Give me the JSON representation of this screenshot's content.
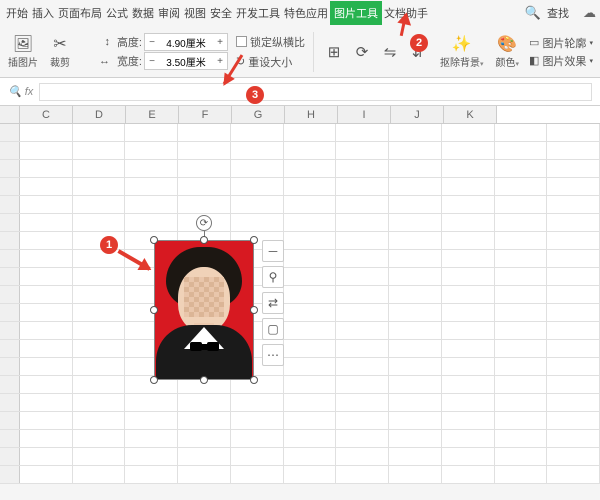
{
  "tabs": {
    "items": [
      "开始",
      "插入",
      "页面布局",
      "公式",
      "数据",
      "审阅",
      "视图",
      "安全",
      "开发工具",
      "特色应用"
    ],
    "active": "图片工具",
    "after": "文档助手",
    "find": "查找"
  },
  "ribbon": {
    "compress": "插图片",
    "crop": "裁剪",
    "height_label": "高度:",
    "width_label": "宽度:",
    "height_value": "4.90厘米",
    "width_value": "3.50厘米",
    "minus": "−",
    "plus": "+",
    "lock": "锁定纵横比",
    "reset": "重设大小",
    "removebg": "抠除背景",
    "color": "颜色",
    "outline": "图片轮廓",
    "effects": "图片效果"
  },
  "cols": [
    "C",
    "D",
    "E",
    "F",
    "G",
    "H",
    "I",
    "J",
    "K"
  ],
  "badges": {
    "b1": "1",
    "b2": "2",
    "b3": "3"
  },
  "float": {
    "minus": "－",
    "zoom": "⚲",
    "switch": "⇄",
    "crop": "▢",
    "more": "⋯"
  }
}
